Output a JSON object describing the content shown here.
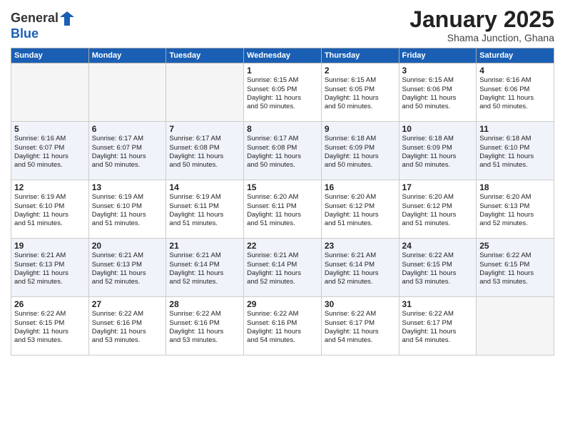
{
  "logo": {
    "line1": "General",
    "line2": "Blue"
  },
  "title": "January 2025",
  "subtitle": "Shama Junction, Ghana",
  "weekdays": [
    "Sunday",
    "Monday",
    "Tuesday",
    "Wednesday",
    "Thursday",
    "Friday",
    "Saturday"
  ],
  "weeks": [
    [
      {
        "day": "",
        "info": ""
      },
      {
        "day": "",
        "info": ""
      },
      {
        "day": "",
        "info": ""
      },
      {
        "day": "1",
        "info": "Sunrise: 6:15 AM\nSunset: 6:05 PM\nDaylight: 11 hours\nand 50 minutes."
      },
      {
        "day": "2",
        "info": "Sunrise: 6:15 AM\nSunset: 6:05 PM\nDaylight: 11 hours\nand 50 minutes."
      },
      {
        "day": "3",
        "info": "Sunrise: 6:15 AM\nSunset: 6:06 PM\nDaylight: 11 hours\nand 50 minutes."
      },
      {
        "day": "4",
        "info": "Sunrise: 6:16 AM\nSunset: 6:06 PM\nDaylight: 11 hours\nand 50 minutes."
      }
    ],
    [
      {
        "day": "5",
        "info": "Sunrise: 6:16 AM\nSunset: 6:07 PM\nDaylight: 11 hours\nand 50 minutes."
      },
      {
        "day": "6",
        "info": "Sunrise: 6:17 AM\nSunset: 6:07 PM\nDaylight: 11 hours\nand 50 minutes."
      },
      {
        "day": "7",
        "info": "Sunrise: 6:17 AM\nSunset: 6:08 PM\nDaylight: 11 hours\nand 50 minutes."
      },
      {
        "day": "8",
        "info": "Sunrise: 6:17 AM\nSunset: 6:08 PM\nDaylight: 11 hours\nand 50 minutes."
      },
      {
        "day": "9",
        "info": "Sunrise: 6:18 AM\nSunset: 6:09 PM\nDaylight: 11 hours\nand 50 minutes."
      },
      {
        "day": "10",
        "info": "Sunrise: 6:18 AM\nSunset: 6:09 PM\nDaylight: 11 hours\nand 50 minutes."
      },
      {
        "day": "11",
        "info": "Sunrise: 6:18 AM\nSunset: 6:10 PM\nDaylight: 11 hours\nand 51 minutes."
      }
    ],
    [
      {
        "day": "12",
        "info": "Sunrise: 6:19 AM\nSunset: 6:10 PM\nDaylight: 11 hours\nand 51 minutes."
      },
      {
        "day": "13",
        "info": "Sunrise: 6:19 AM\nSunset: 6:10 PM\nDaylight: 11 hours\nand 51 minutes."
      },
      {
        "day": "14",
        "info": "Sunrise: 6:19 AM\nSunset: 6:11 PM\nDaylight: 11 hours\nand 51 minutes."
      },
      {
        "day": "15",
        "info": "Sunrise: 6:20 AM\nSunset: 6:11 PM\nDaylight: 11 hours\nand 51 minutes."
      },
      {
        "day": "16",
        "info": "Sunrise: 6:20 AM\nSunset: 6:12 PM\nDaylight: 11 hours\nand 51 minutes."
      },
      {
        "day": "17",
        "info": "Sunrise: 6:20 AM\nSunset: 6:12 PM\nDaylight: 11 hours\nand 51 minutes."
      },
      {
        "day": "18",
        "info": "Sunrise: 6:20 AM\nSunset: 6:13 PM\nDaylight: 11 hours\nand 52 minutes."
      }
    ],
    [
      {
        "day": "19",
        "info": "Sunrise: 6:21 AM\nSunset: 6:13 PM\nDaylight: 11 hours\nand 52 minutes."
      },
      {
        "day": "20",
        "info": "Sunrise: 6:21 AM\nSunset: 6:13 PM\nDaylight: 11 hours\nand 52 minutes."
      },
      {
        "day": "21",
        "info": "Sunrise: 6:21 AM\nSunset: 6:14 PM\nDaylight: 11 hours\nand 52 minutes."
      },
      {
        "day": "22",
        "info": "Sunrise: 6:21 AM\nSunset: 6:14 PM\nDaylight: 11 hours\nand 52 minutes."
      },
      {
        "day": "23",
        "info": "Sunrise: 6:21 AM\nSunset: 6:14 PM\nDaylight: 11 hours\nand 52 minutes."
      },
      {
        "day": "24",
        "info": "Sunrise: 6:22 AM\nSunset: 6:15 PM\nDaylight: 11 hours\nand 53 minutes."
      },
      {
        "day": "25",
        "info": "Sunrise: 6:22 AM\nSunset: 6:15 PM\nDaylight: 11 hours\nand 53 minutes."
      }
    ],
    [
      {
        "day": "26",
        "info": "Sunrise: 6:22 AM\nSunset: 6:15 PM\nDaylight: 11 hours\nand 53 minutes."
      },
      {
        "day": "27",
        "info": "Sunrise: 6:22 AM\nSunset: 6:16 PM\nDaylight: 11 hours\nand 53 minutes."
      },
      {
        "day": "28",
        "info": "Sunrise: 6:22 AM\nSunset: 6:16 PM\nDaylight: 11 hours\nand 53 minutes."
      },
      {
        "day": "29",
        "info": "Sunrise: 6:22 AM\nSunset: 6:16 PM\nDaylight: 11 hours\nand 54 minutes."
      },
      {
        "day": "30",
        "info": "Sunrise: 6:22 AM\nSunset: 6:17 PM\nDaylight: 11 hours\nand 54 minutes."
      },
      {
        "day": "31",
        "info": "Sunrise: 6:22 AM\nSunset: 6:17 PM\nDaylight: 11 hours\nand 54 minutes."
      },
      {
        "day": "",
        "info": ""
      }
    ]
  ]
}
